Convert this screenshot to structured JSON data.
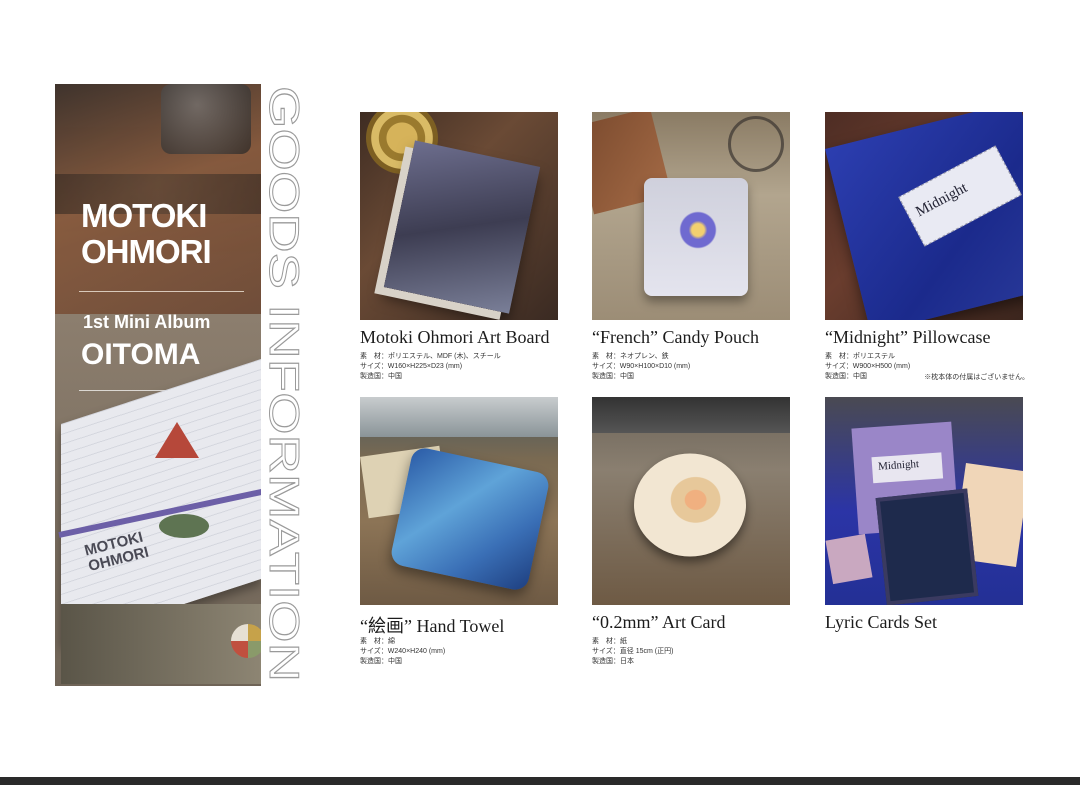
{
  "banner": {
    "artist_line1": "MOTOKI",
    "artist_line2": "OHMORI",
    "subtitle": "1st Mini Album",
    "album": "OITOMA",
    "box_logo_line1": "MOTOKI",
    "box_logo_line2": "OHMORI"
  },
  "vertical_heading": "GOODS INFORMATION",
  "products": [
    {
      "name": "Motoki Ohmori Art Board",
      "specs": [
        "素　材：ポリエステル、MDF (木)、スチール",
        "サイズ：W160×H225×D23 (mm)",
        "製造国：中国"
      ]
    },
    {
      "name": "“French” Candy Pouch",
      "specs": [
        "素　材：ネオプレン、鉄",
        "サイズ：W90×H100×D10 (mm)",
        "製造国：中国"
      ]
    },
    {
      "name": "“Midnight” Pillowcase",
      "specs": [
        "素　材：ポリエステル",
        "サイズ：W900×H500 (mm)",
        "製造国：中国"
      ],
      "note": "※枕本体の付属はございません。",
      "photo_text": "Midnight"
    },
    {
      "name": "“絵画” Hand Towel",
      "specs": [
        "素　材：綿",
        "サイズ：W240×H240 (mm)",
        "製造国：中国"
      ]
    },
    {
      "name": "“0.2mm” Art Card",
      "specs": [
        "素　材：紙",
        "サイズ：直径 15cm (正円)",
        "製造国：日本"
      ]
    },
    {
      "name": "Lyric Cards Set",
      "specs": [],
      "photo_text": "Midnight"
    }
  ]
}
